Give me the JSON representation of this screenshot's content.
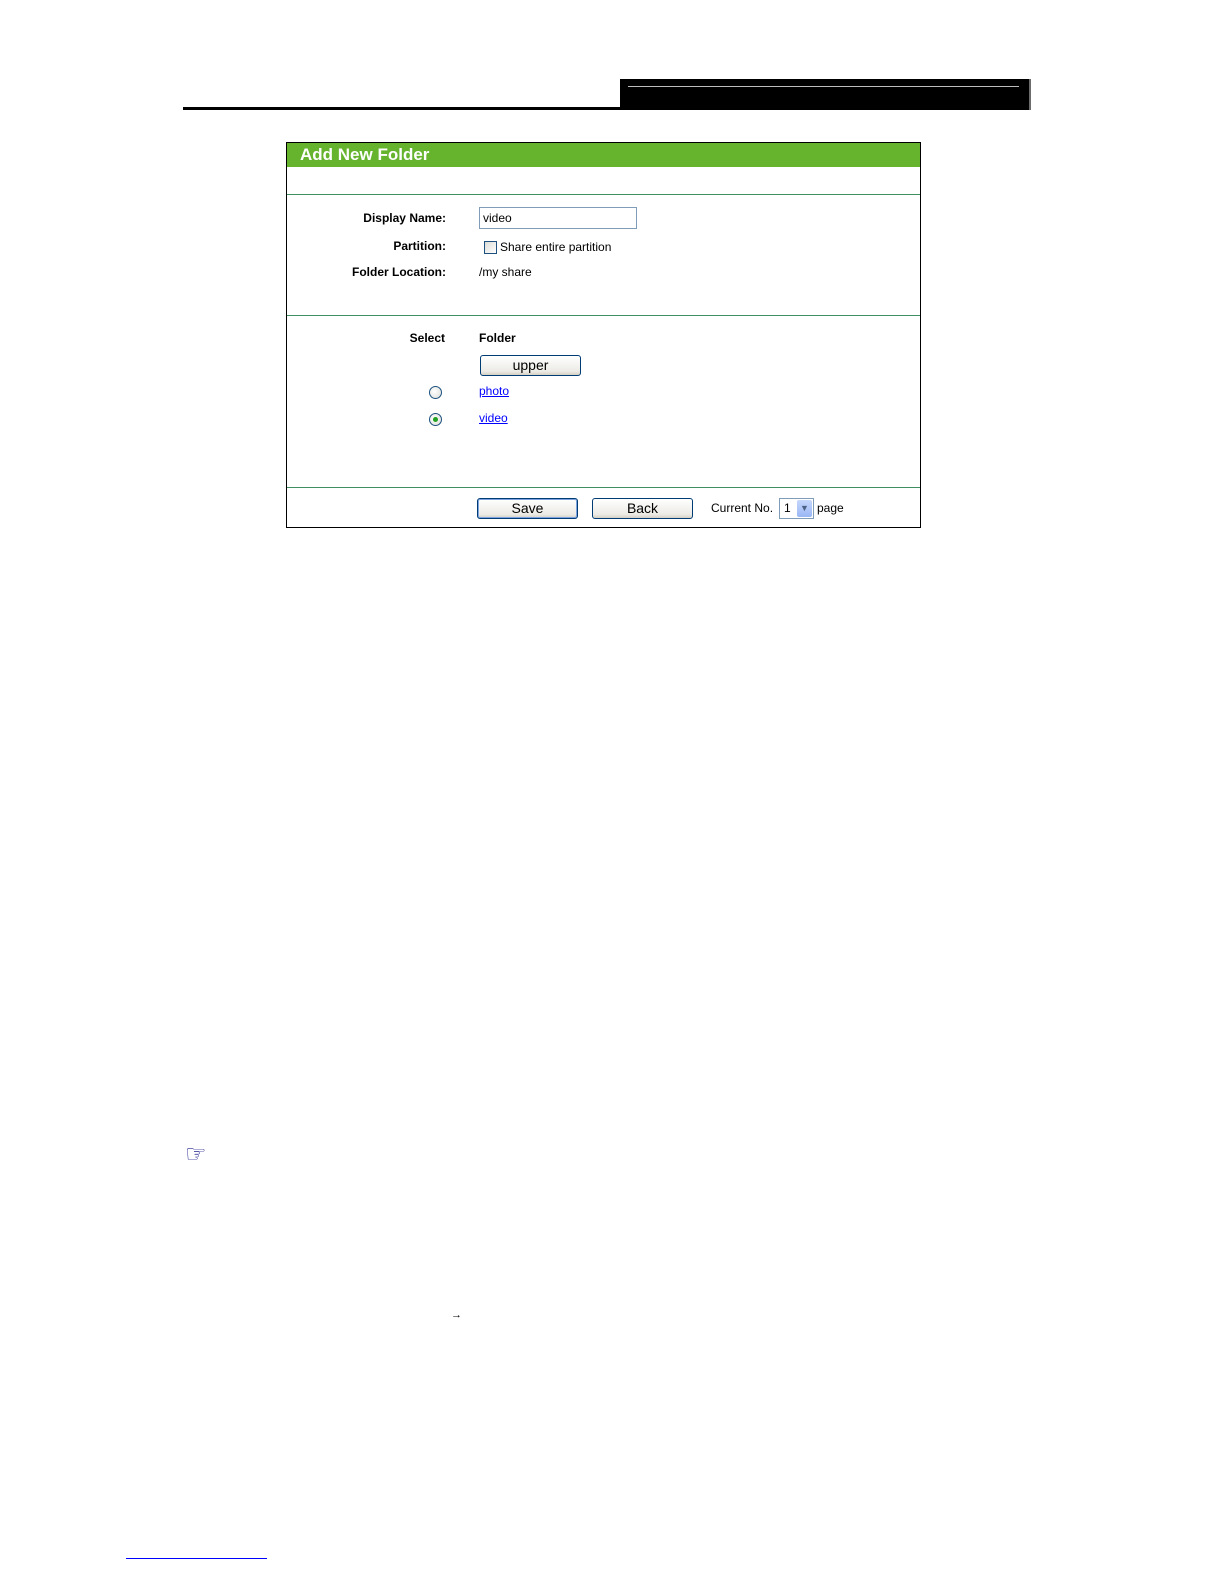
{
  "panel": {
    "title": "Add New Folder"
  },
  "form": {
    "display_name_label": "Display Name:",
    "display_name_value": "video",
    "partition_label": "Partition:",
    "partition_checkbox_label": "Share entire partition",
    "partition_checked": false,
    "folder_location_label": "Folder Location:",
    "folder_location_value": "/my share"
  },
  "folder_list": {
    "select_header": "Select",
    "folder_header": "Folder",
    "upper_button": "upper",
    "items": [
      {
        "name": "photo",
        "selected": false
      },
      {
        "name": "video",
        "selected": true
      }
    ]
  },
  "footer": {
    "save_button": "Save",
    "back_button": "Back",
    "current_no_label": "Current No.",
    "page_select_value": "1",
    "page_label": "page"
  },
  "colors": {
    "title_bar": "#66b42e",
    "divider": "#3f8f60",
    "link": "#0000ff"
  }
}
